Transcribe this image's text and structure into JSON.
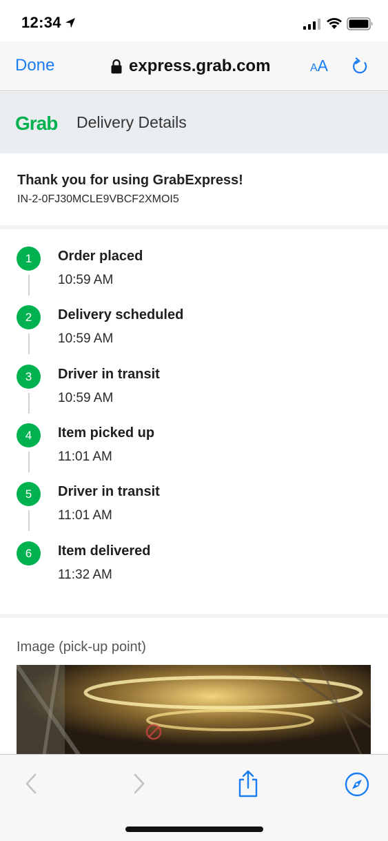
{
  "status_bar": {
    "time": "12:34"
  },
  "browser": {
    "done_label": "Done",
    "url": "express.grab.com",
    "text_size_small": "A",
    "text_size_large": "A"
  },
  "header": {
    "logo_text": "Grab",
    "title": "Delivery Details"
  },
  "order": {
    "thanks_text": "Thank you for using GrabExpress!",
    "order_id": "IN-2-0FJ30MCLE9VBCF2XMOI5"
  },
  "timeline": {
    "steps": [
      {
        "number": "1",
        "label": "Order placed",
        "time": "10:59 AM"
      },
      {
        "number": "2",
        "label": "Delivery scheduled",
        "time": "10:59 AM"
      },
      {
        "number": "3",
        "label": "Driver in transit",
        "time": "10:59 AM"
      },
      {
        "number": "4",
        "label": "Item picked up",
        "time": "11:01 AM"
      },
      {
        "number": "5",
        "label": "Driver in transit",
        "time": "11:01 AM"
      },
      {
        "number": "6",
        "label": "Item delivered",
        "time": "11:32 AM"
      }
    ]
  },
  "image_section": {
    "label": "Image (pick-up point)"
  },
  "colors": {
    "accent": "#1a7cf2",
    "grab_green": "#00b14f",
    "header_bg": "#e9edf0"
  },
  "icons": {
    "location": "location-arrow-icon",
    "signal": "cellular-signal-icon",
    "wifi": "wifi-icon",
    "battery": "battery-icon",
    "lock": "lock-icon",
    "reload": "reload-icon",
    "back": "chevron-left-icon",
    "forward": "chevron-right-icon",
    "share": "share-icon",
    "compass": "compass-icon"
  }
}
